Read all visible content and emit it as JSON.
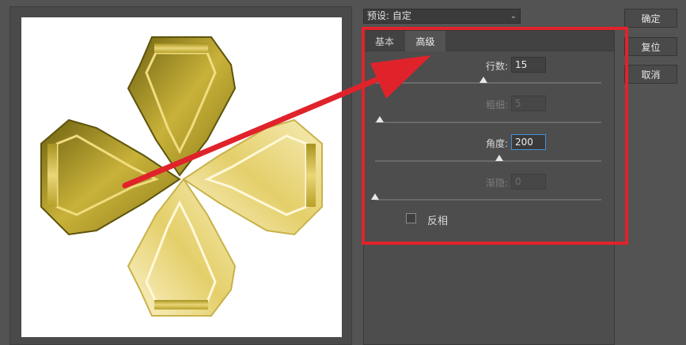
{
  "preset": {
    "label": "预设: 自定"
  },
  "buttons": {
    "ok": "确定",
    "reset": "复位",
    "cancel": "取消"
  },
  "tabs": {
    "basic": "基本",
    "advanced": "高级",
    "active": "advanced"
  },
  "settings": {
    "rows": {
      "label": "行数:",
      "value": "15",
      "slider": 0.48
    },
    "thickness": {
      "label": "粗细:",
      "value": "5",
      "slider": 0.02,
      "disabled": true
    },
    "angle": {
      "label": "角度:",
      "value": "200",
      "slider": 0.55
    },
    "fade": {
      "label": "渐隐:",
      "value": "0",
      "slider": 0.0,
      "disabled": true
    },
    "invert": {
      "label": "反相",
      "checked": false
    }
  },
  "annotation": {
    "color": "#e0232b"
  },
  "colors": {
    "panel": "#535353",
    "gold_light": "#f3e6a0",
    "gold_dark": "#8a7a17"
  }
}
